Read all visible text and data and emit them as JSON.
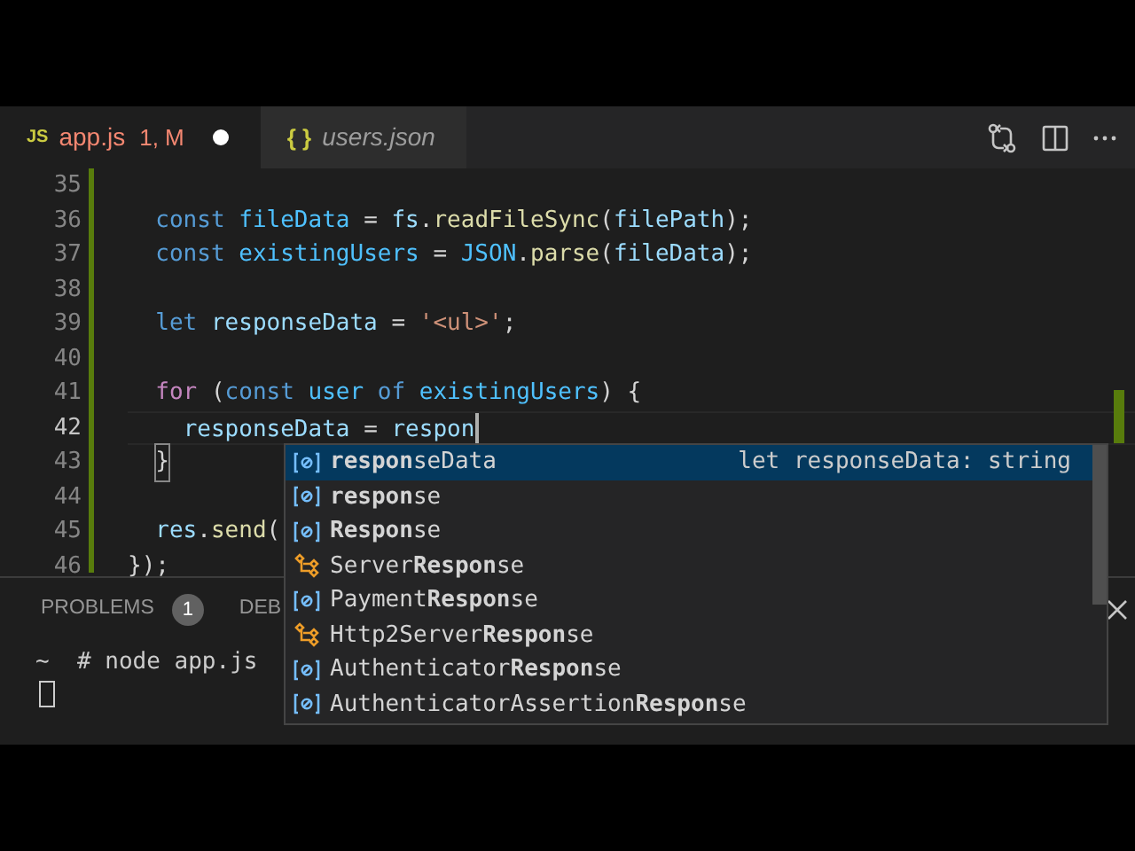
{
  "tabs": [
    {
      "icon_text": "JS",
      "label": "app.js",
      "badge": "1, M",
      "has_errors": true,
      "dirty": true,
      "preview": false,
      "selected": true
    },
    {
      "icon_text": "{ }",
      "label": "users.json",
      "has_errors": false,
      "dirty": false,
      "preview": true,
      "selected": false
    }
  ],
  "editor": {
    "lines": [
      {
        "number": "35"
      },
      {
        "number": "36",
        "tokens": [
          {
            "text": "  const ",
            "kind": "keyword"
          },
          {
            "text": "fileData",
            "kind": "constant"
          },
          {
            "text": " = ",
            "kind": "plain"
          },
          {
            "text": "fs",
            "kind": "variable"
          },
          {
            "text": ".",
            "kind": "plain"
          },
          {
            "text": "readFileSync",
            "kind": "function"
          },
          {
            "text": "(",
            "kind": "plain"
          },
          {
            "text": "filePath",
            "kind": "variable"
          },
          {
            "text": ");",
            "kind": "plain"
          }
        ]
      },
      {
        "number": "37",
        "tokens": [
          {
            "text": "  const ",
            "kind": "keyword"
          },
          {
            "text": "existingUsers",
            "kind": "constant"
          },
          {
            "text": " = ",
            "kind": "plain"
          },
          {
            "text": "JSON",
            "kind": "constant"
          },
          {
            "text": ".",
            "kind": "plain"
          },
          {
            "text": "parse",
            "kind": "function"
          },
          {
            "text": "(",
            "kind": "plain"
          },
          {
            "text": "fileData",
            "kind": "variable"
          },
          {
            "text": ");",
            "kind": "plain"
          }
        ]
      },
      {
        "number": "38"
      },
      {
        "number": "39",
        "tokens": [
          {
            "text": "  let ",
            "kind": "keyword"
          },
          {
            "text": "responseData",
            "kind": "variable"
          },
          {
            "text": " = ",
            "kind": "plain"
          },
          {
            "text": "'<ul>'",
            "kind": "string"
          },
          {
            "text": ";",
            "kind": "plain"
          }
        ]
      },
      {
        "number": "40"
      },
      {
        "number": "41",
        "tokens": [
          {
            "text": "  for ",
            "kind": "control"
          },
          {
            "text": "(",
            "kind": "plain"
          },
          {
            "text": "const ",
            "kind": "keyword"
          },
          {
            "text": "user ",
            "kind": "constant"
          },
          {
            "text": "of ",
            "kind": "keyword"
          },
          {
            "text": "existingUsers",
            "kind": "constant"
          },
          {
            "text": ") {",
            "kind": "plain"
          }
        ]
      },
      {
        "number": "42",
        "current": true,
        "cursor": true,
        "tokens": [
          {
            "text": "    responseData",
            "kind": "variable"
          },
          {
            "text": " = ",
            "kind": "plain"
          },
          {
            "text": "respon",
            "kind": "variable"
          }
        ]
      },
      {
        "number": "43",
        "tokens": [
          {
            "text": "  }",
            "kind": "matched"
          }
        ]
      },
      {
        "number": "44"
      },
      {
        "number": "45",
        "tokens": [
          {
            "text": "  res",
            "kind": "variable"
          },
          {
            "text": ".",
            "kind": "plain"
          },
          {
            "text": "send",
            "kind": "function"
          },
          {
            "text": "(",
            "kind": "plain"
          }
        ]
      },
      {
        "number": "46",
        "tokens": [
          {
            "text": "});",
            "kind": "plain"
          }
        ]
      }
    ]
  },
  "suggestions": [
    {
      "kind": "variable",
      "label": "**respon**seData",
      "detail": "let responseData: string",
      "selected": true
    },
    {
      "kind": "variable",
      "label": "**respon**se",
      "selected": false
    },
    {
      "kind": "variable",
      "label": "**Respon**se",
      "selected": false
    },
    {
      "kind": "class",
      "label": "Server**Respon**se",
      "selected": false
    },
    {
      "kind": "variable",
      "label": "Payment**Respon**se",
      "selected": false
    },
    {
      "kind": "class",
      "label": "Http2Server**Respon**se",
      "selected": false
    },
    {
      "kind": "variable",
      "label": "Authenticator**Respon**se",
      "selected": false
    },
    {
      "kind": "variable",
      "label": "AuthenticatorAssertion**Respon**se",
      "selected": false
    }
  ],
  "panel": {
    "tabs": [
      {
        "label": "PROBLEMS",
        "badge": "1",
        "selected": false
      },
      {
        "label": "DEB",
        "selected": false
      }
    ],
    "terminal": {
      "lines": [
        "~  # node app.js"
      ],
      "cursor": true
    }
  }
}
